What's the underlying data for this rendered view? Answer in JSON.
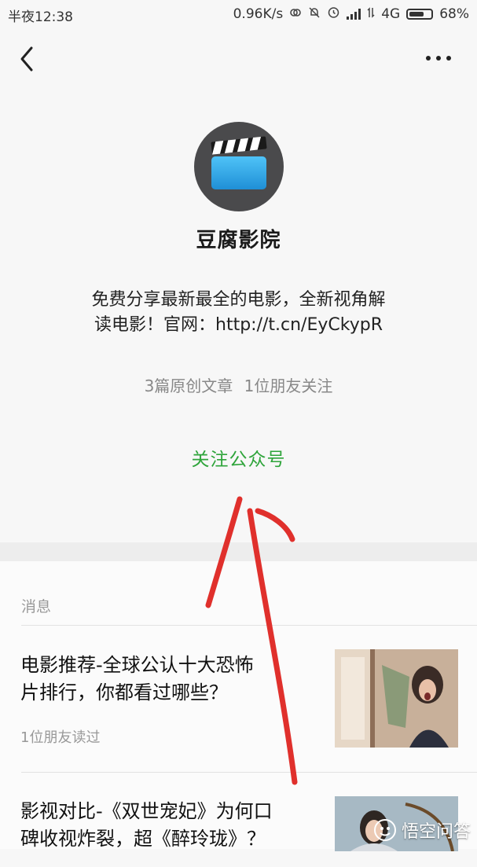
{
  "status_bar": {
    "time": "半夜12:38",
    "network_speed": "0.96K/s",
    "network_type": "4G",
    "battery_percent": "68%",
    "battery_level": 0.68
  },
  "nav": {
    "back_icon": "chevron-left-icon",
    "more_icon": "more-dots-icon"
  },
  "account": {
    "name": "豆腐影院",
    "description_line1": "免费分享最新最全的电影，全新视角解",
    "description_line2": "读电影！官网：http://t.cn/EyCkypR",
    "stat_articles": "3篇原创文章",
    "stat_friends": "1位朋友关注",
    "follow_label": "关注公众号"
  },
  "messages": {
    "section_label": "消息",
    "articles": [
      {
        "title_line1": "电影推荐-全球公认十大恐怖",
        "title_line2": "片排行，你都看过哪些？",
        "meta": "1位朋友读过"
      },
      {
        "title_line1": "影视对比-《双世宠妃》为何口",
        "title_line2": "碑收视炸裂，超《醉玲珑》？"
      }
    ]
  },
  "watermark": {
    "text": "悟空问答"
  },
  "colors": {
    "accent_green": "#2ea43a",
    "annotation_red": "#e0302c",
    "background": "#f7f7f7"
  }
}
